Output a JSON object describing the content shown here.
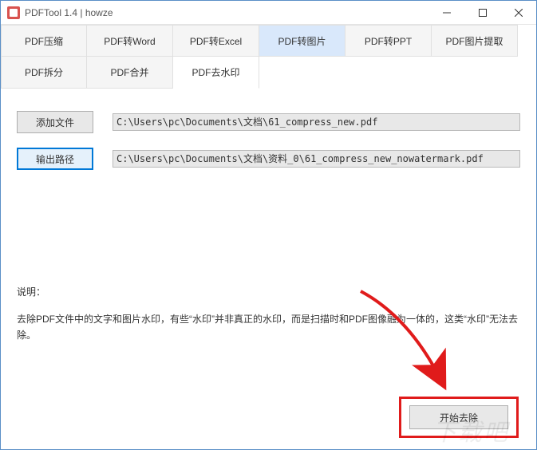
{
  "titlebar": {
    "title": "PDFTool 1.4 |  howze"
  },
  "tabs": {
    "row1": [
      {
        "label": "PDF压缩"
      },
      {
        "label": "PDF转Word"
      },
      {
        "label": "PDF转Excel"
      },
      {
        "label": "PDF转图片"
      },
      {
        "label": "PDF转PPT"
      },
      {
        "label": "PDF图片提取"
      }
    ],
    "row2": [
      {
        "label": "PDF拆分"
      },
      {
        "label": "PDF合并"
      },
      {
        "label": "PDF去水印"
      }
    ]
  },
  "buttons": {
    "add_file": "添加文件",
    "output_path": "输出路径",
    "start": "开始去除"
  },
  "paths": {
    "input": "C:\\Users\\pc\\Documents\\文档\\61_compress_new.pdf",
    "output": "C:\\Users\\pc\\Documents\\文档\\资料_0\\61_compress_new_nowatermark.pdf"
  },
  "desc": {
    "label": "说明：",
    "text": "去除PDF文件中的文字和图片水印，有些“水印”并非真正的水印，而是扫描时和PDF图像融为一体的，这类“水印”无法去除。"
  },
  "watermark": "下载吧"
}
